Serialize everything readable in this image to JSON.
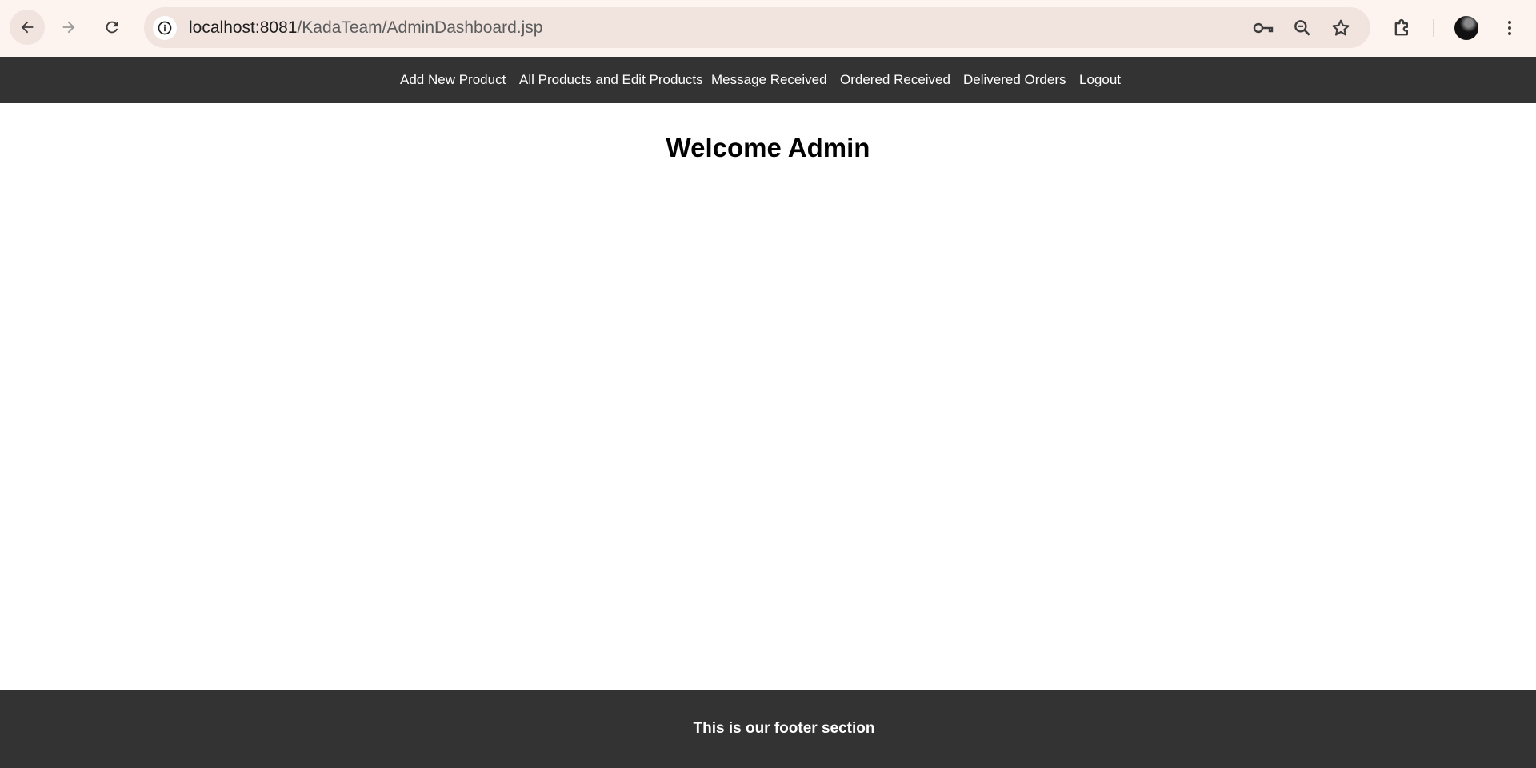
{
  "browser": {
    "url_host": "localhost:8081",
    "url_path": "/KadaTeam/AdminDashboard.jsp",
    "icons": {
      "back": "arrow-left-icon",
      "forward": "arrow-right-icon",
      "reload": "reload-icon",
      "site_info": "info-icon",
      "password": "key-icon",
      "zoom": "zoom-out-icon",
      "bookmark": "star-icon",
      "extensions": "puzzle-icon",
      "menu": "kebab-menu-icon"
    }
  },
  "nav": {
    "items": [
      {
        "label": "Add New Product"
      },
      {
        "label": "All Products and Edit Products"
      },
      {
        "label": "Message Received"
      },
      {
        "label": "Ordered Received"
      },
      {
        "label": "Delivered Orders"
      },
      {
        "label": "Logout"
      }
    ]
  },
  "main": {
    "title": "Welcome Admin"
  },
  "footer": {
    "text": "This is our footer section"
  },
  "colors": {
    "nav_background": "#333333",
    "footer_background": "#333333",
    "browser_bar": "#fdf3ef",
    "address_bar": "#f1e4df"
  }
}
